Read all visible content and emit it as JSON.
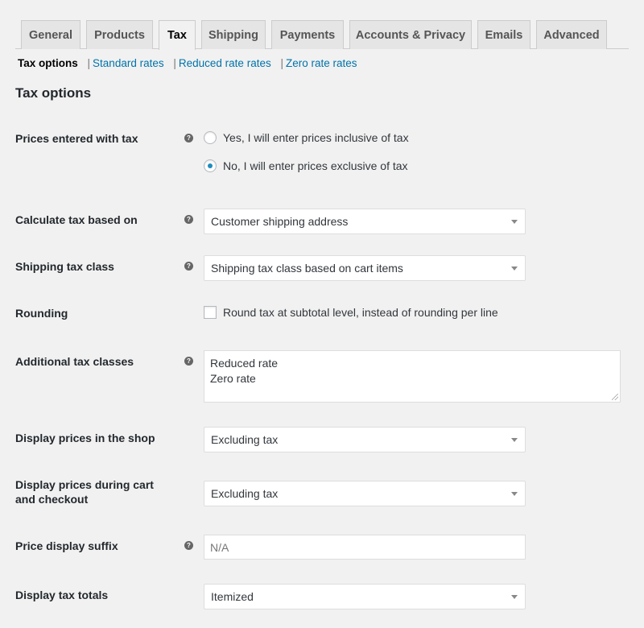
{
  "tabs": [
    {
      "label": "General"
    },
    {
      "label": "Products"
    },
    {
      "label": "Tax"
    },
    {
      "label": "Shipping"
    },
    {
      "label": "Payments"
    },
    {
      "label": "Accounts & Privacy"
    },
    {
      "label": "Emails"
    },
    {
      "label": "Advanced"
    }
  ],
  "subnav": {
    "current": "Tax options",
    "links": [
      "Standard rates",
      "Reduced rate rates",
      "Zero rate rates"
    ],
    "separator": "|"
  },
  "section_title": "Tax options",
  "help_glyph": "?",
  "fields": {
    "prices_entered_with_tax": {
      "label": "Prices entered with tax",
      "options": [
        {
          "label": "Yes, I will enter prices inclusive of tax",
          "checked": false
        },
        {
          "label": "No, I will enter prices exclusive of tax",
          "checked": true
        }
      ]
    },
    "calculate_tax_based_on": {
      "label": "Calculate tax based on",
      "value": "Customer shipping address"
    },
    "shipping_tax_class": {
      "label": "Shipping tax class",
      "value": "Shipping tax class based on cart items"
    },
    "rounding": {
      "label": "Rounding",
      "checkbox_label": "Round tax at subtotal level, instead of rounding per line",
      "checked": false
    },
    "additional_tax_classes": {
      "label": "Additional tax classes",
      "lines": [
        "Reduced rate",
        "Zero rate"
      ]
    },
    "display_prices_in_shop": {
      "label": "Display prices in the shop",
      "value": "Excluding tax"
    },
    "display_prices_cart": {
      "label_line1": "Display prices during cart",
      "label_line2": "and checkout",
      "value": "Excluding tax"
    },
    "price_display_suffix": {
      "label": "Price display suffix",
      "placeholder": "N/A"
    },
    "display_tax_totals": {
      "label": "Display tax totals",
      "value": "Itemized"
    }
  },
  "colors": {
    "link": "#0073aa",
    "radio_checked": "#1e8cbe"
  }
}
